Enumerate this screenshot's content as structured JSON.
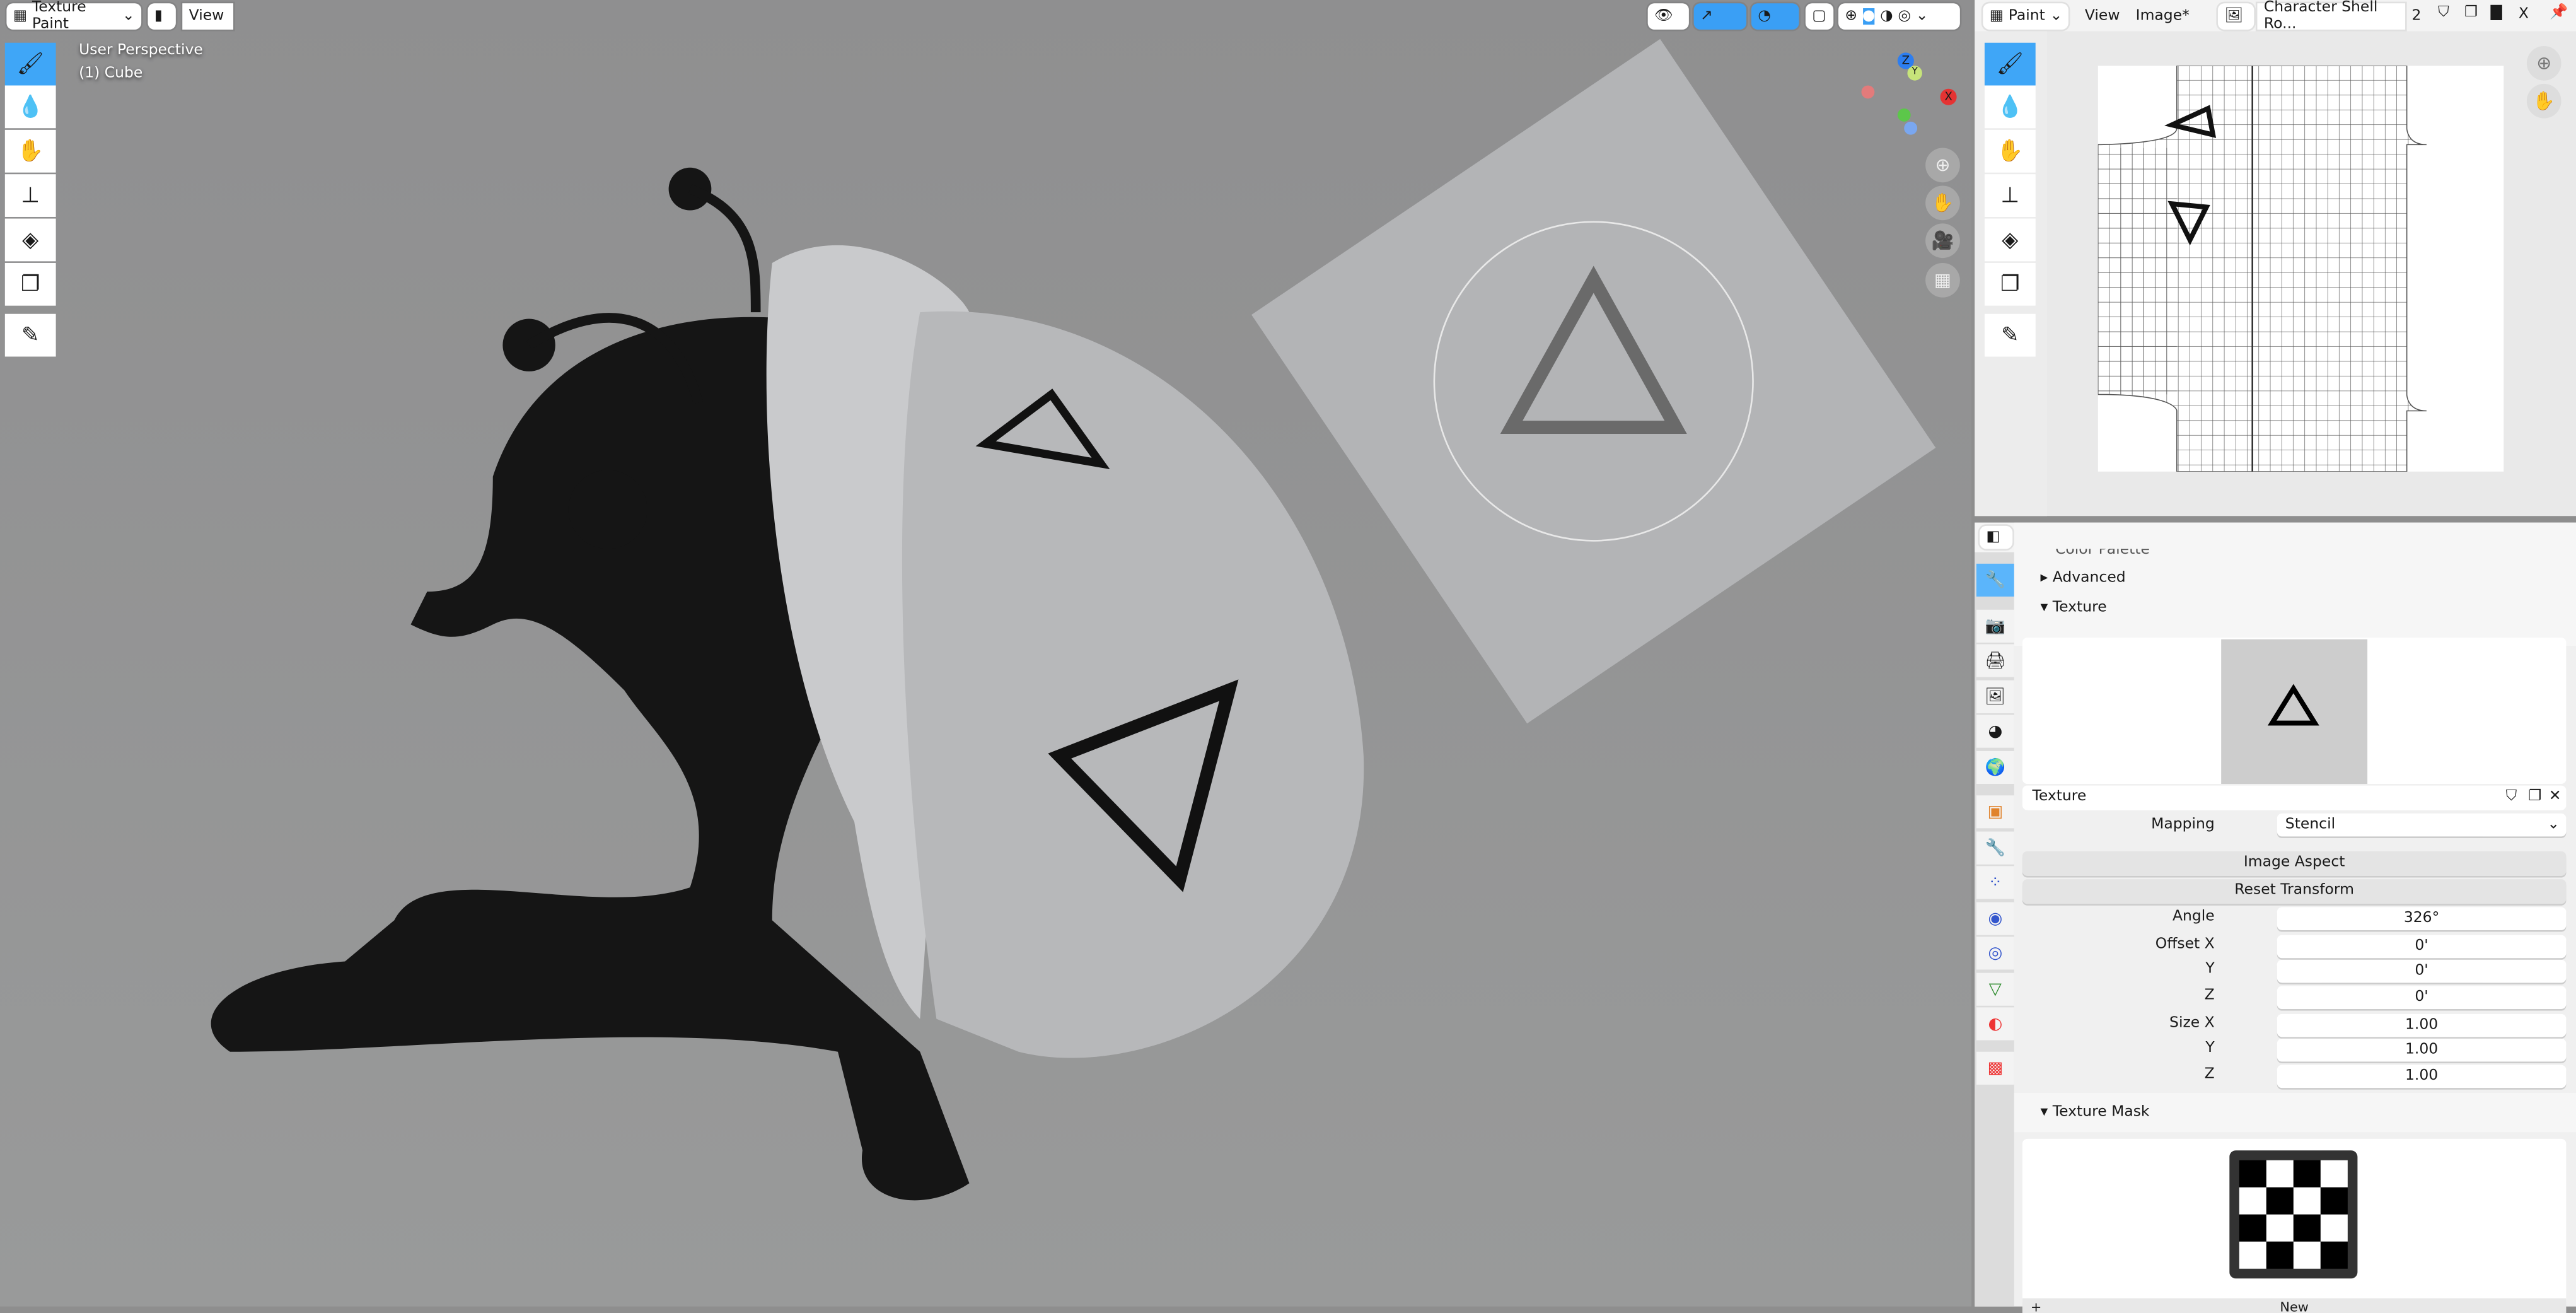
{
  "viewport": {
    "mode_label": "Texture Paint",
    "view_menu": "View",
    "overlay_title": "User Perspective",
    "overlay_object": "(1) Cube",
    "tools": [
      "brush-icon",
      "drop-icon",
      "smear-icon",
      "stamp-icon",
      "fill-icon",
      "mask-icon",
      "annotate-icon"
    ],
    "gizmo": {
      "z": "Z",
      "x": "X",
      "y": "Y"
    },
    "colors": {
      "background": "#909090",
      "active_tool": "#3fa6f7",
      "shell": "#b8b9bb",
      "body": "#151515",
      "stencil": "#b3b4b6"
    }
  },
  "image_editor": {
    "mode_label": "Paint",
    "menu_view": "View",
    "menu_image": "Image*",
    "image_name": "Character Shell Ro...",
    "users_count": "2",
    "close": "X"
  },
  "properties": {
    "cut_off_section": "Color Palette",
    "sections": {
      "advanced": "Advanced",
      "texture": "Texture",
      "texture_mask": "Texture Mask"
    },
    "texture_name": "Texture",
    "mapping": {
      "label": "Mapping",
      "value": "Stencil"
    },
    "buttons": {
      "image_aspect": "Image Aspect",
      "reset_transform": "Reset Transform",
      "new": "New"
    },
    "angle": {
      "label": "Angle",
      "value": "326°"
    },
    "offset": {
      "label_x": "Offset X",
      "label_y": "Y",
      "label_z": "Z",
      "x": "0'",
      "y": "0'",
      "z": "0'"
    },
    "size": {
      "label_x": "Size X",
      "label_y": "Y",
      "label_z": "Z",
      "x": "1.00",
      "y": "1.00",
      "z": "1.00"
    },
    "tab_icons": [
      "tool-icon",
      "render-icon",
      "output-icon",
      "view-layer-icon",
      "scene-icon",
      "world-icon",
      "object-icon",
      "modifier-icon",
      "particles-icon",
      "physics-icon",
      "constraints-icon",
      "data-icon",
      "material-icon",
      "texture-icon"
    ]
  }
}
